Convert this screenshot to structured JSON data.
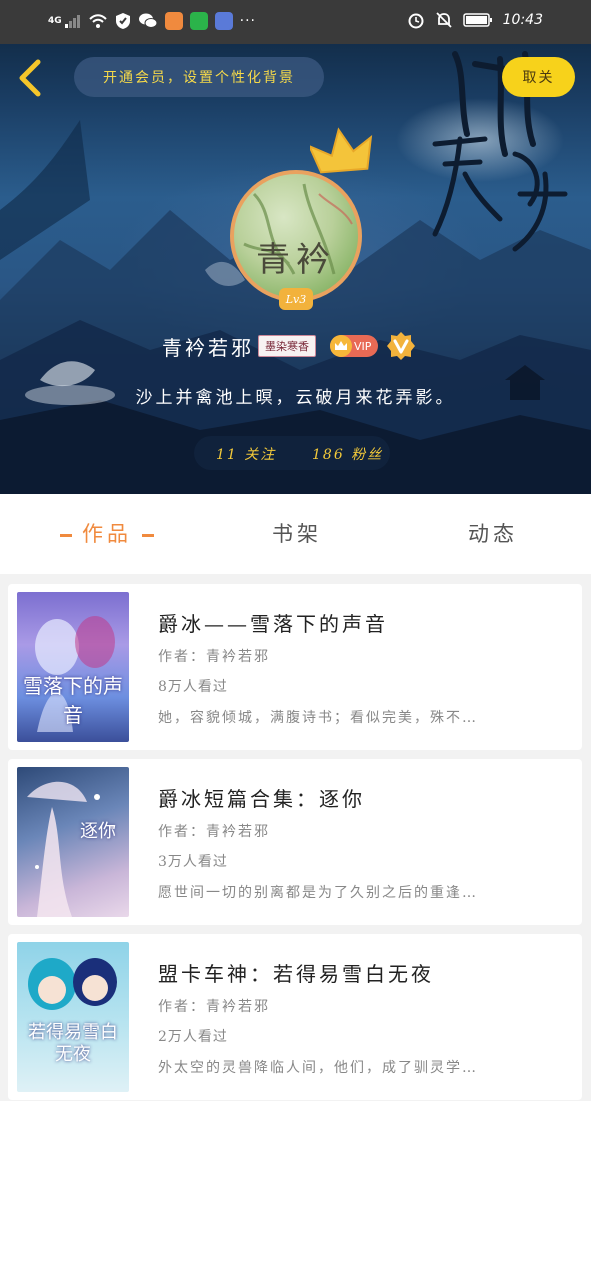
{
  "status_bar": {
    "network": "4G",
    "time": "10:43",
    "more": "···"
  },
  "header": {
    "promo_text": "开通会员，设置个性化背景",
    "follow_button": "取关",
    "avatar_text": "青衿",
    "level": "Lv3",
    "username": "青衿若邪",
    "tag_badge": "墨染寒香",
    "vip_label": "VIP",
    "signature": "沙上并禽池上暝，云破月来花弄影。",
    "following": "11 关注",
    "followers": "186 粉丝"
  },
  "tabs": [
    {
      "label": "作品",
      "active": true
    },
    {
      "label": "书架",
      "active": false
    },
    {
      "label": "动态",
      "active": false
    }
  ],
  "books": [
    {
      "title": "爵冰——雪落下的声音",
      "author": "作者：青衿若邪",
      "views": "8万人看过",
      "desc": "她，容貌倾城，满腹诗书；看似完美，殊不…",
      "cover_text": "雪落下的声音"
    },
    {
      "title": "爵冰短篇合集：逐你",
      "author": "作者：青衿若邪",
      "views": "3万人看过",
      "desc": "愿世间一切的别离都是为了久别之后的重逢…",
      "cover_text": "逐你"
    },
    {
      "title": "盟卡车神：若得易雪白无夜",
      "author": "作者：青衿若邪",
      "views": "2万人看过",
      "desc": "外太空的灵兽降临人间，他们，成了驯灵学…",
      "cover_text": "若得易雪白无夜"
    }
  ],
  "colors": {
    "accent": "#f08a3e",
    "follow_button": "#f7d21b",
    "promo_text": "#f5d94a",
    "stats_text": "#f2c93a"
  }
}
